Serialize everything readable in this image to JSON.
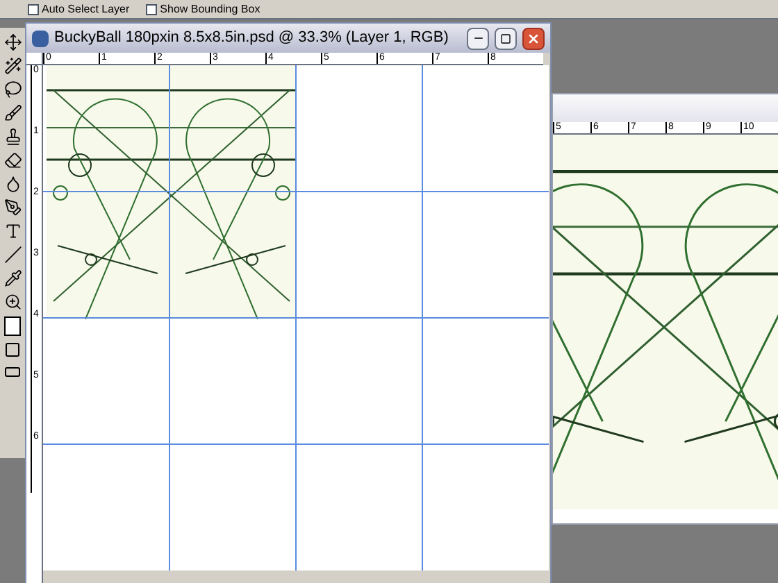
{
  "options_bar": {
    "checkboxes": [
      {
        "label": "Auto Select Layer",
        "checked": false
      },
      {
        "label": "Show Bounding Box",
        "checked": false
      }
    ]
  },
  "document": {
    "title": "BuckyBall 180pxin 8.5x8.5in.psd @ 33.3% (Layer 1, RGB)",
    "active": true,
    "top_ruler": [
      "0",
      "1",
      "2",
      "3",
      "4",
      "5",
      "6",
      "7",
      "8"
    ],
    "left_ruler": [
      "0",
      "1",
      "2",
      "3",
      "4",
      "5",
      "6"
    ]
  },
  "second_window": {
    "active": false,
    "top_ruler": [
      "5",
      "6",
      "7",
      "8",
      "9",
      "10"
    ]
  }
}
